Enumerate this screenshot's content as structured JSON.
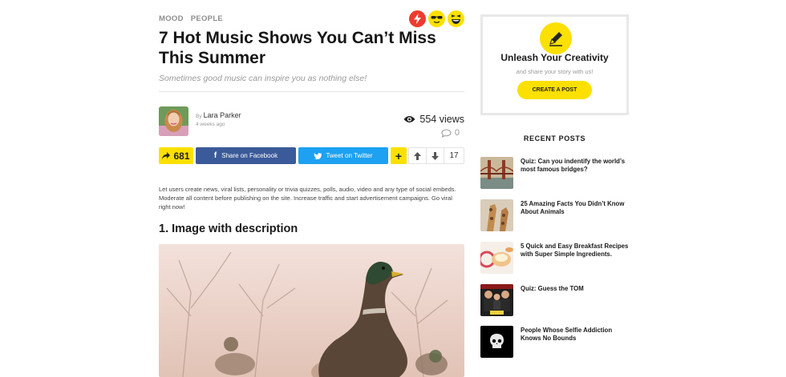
{
  "article": {
    "categories": [
      "MOOD",
      "PEOPLE"
    ],
    "reactions": [
      {
        "icon": "lightning-icon",
        "color": "#ee3b2f"
      },
      {
        "icon": "cool-face-icon",
        "color": "#fbe000"
      },
      {
        "icon": "laughing-face-icon",
        "color": "#fbe000"
      }
    ],
    "title": "7 Hot Music Shows You Can’t Miss This Summer",
    "subtitle": "Sometimes good music can inspire you as nothing else!",
    "author": {
      "by": "By",
      "name": "Lara Parker",
      "time_ago": "4 weeks ago"
    },
    "views": "554 views",
    "comments": "0",
    "shares": "681",
    "share_facebook": "Share on Facebook",
    "share_twitter": "Tweet on Twitter",
    "more_label": "+",
    "vote_score": "17",
    "body": "Let users create news, viral lists, personality or trivia quizzes, polls, audio, video and any type of social embeds. Moderate all content before publishing on the site. Increase traffic and start advertisement campaigns. Go viral right now!",
    "section_heading": "1. Image with description"
  },
  "sidebar": {
    "promo": {
      "title": "Unleash Your Creativity",
      "subtitle": "and share your story with us!",
      "button": "CREATE A POST"
    },
    "recent_heading": "RECENT POSTS",
    "recent_posts": [
      {
        "title": "Quiz: Can you indentify the world’s most famous bridges?"
      },
      {
        "title": "25 Amazing Facts You Didn’t Know About Animals"
      },
      {
        "title": "5 Quick and Easy Breakfast Recipes with Super Simple Ingredients."
      },
      {
        "title": "Quiz: Guess the TOM"
      },
      {
        "title": "People Whose Selfie Addiction Knows No Bounds"
      }
    ]
  },
  "colors": {
    "accent_yellow": "#fbe000",
    "facebook": "#3b5a99",
    "twitter": "#1da1f2"
  }
}
